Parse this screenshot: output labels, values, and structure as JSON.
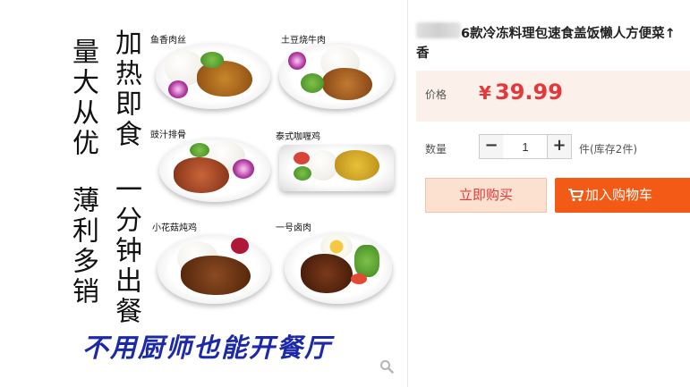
{
  "image": {
    "slogan_col1_top": "量大从优",
    "slogan_col1_bottom": "薄利多销",
    "slogan_col2_top": "加热即食",
    "slogan_col2_bottom": "一分钟出餐",
    "bottom_slogan": "不用厨师也能开餐厅",
    "dishes": [
      {
        "label": "鱼香肉丝"
      },
      {
        "label": "土豆烧牛肉"
      },
      {
        "label": "豉汁排骨"
      },
      {
        "label": "泰式咖喱鸡"
      },
      {
        "label": "小花菇炖鸡"
      },
      {
        "label": "一号卤肉"
      }
    ]
  },
  "product": {
    "title_line1": "6款冷冻料理包速食盖饭懒人方便菜↑",
    "title_line2": "香",
    "price_label": "价格",
    "price_symbol": "¥",
    "price_value": "39.99",
    "quantity_label": "数量",
    "quantity_value": "1",
    "minus_symbol": "−",
    "plus_symbol": "+",
    "stock_text": "件(库存2件)",
    "buy_now_label": "立即购买",
    "add_to_cart_label": "加入购物车"
  },
  "colors": {
    "price": "#e4393c",
    "cart_button": "#f25a15",
    "buy_now_bg": "#fde1d0",
    "slogan_blue": "#1d2aa8"
  },
  "icons": [
    "zoom-icon",
    "cart-icon"
  ]
}
